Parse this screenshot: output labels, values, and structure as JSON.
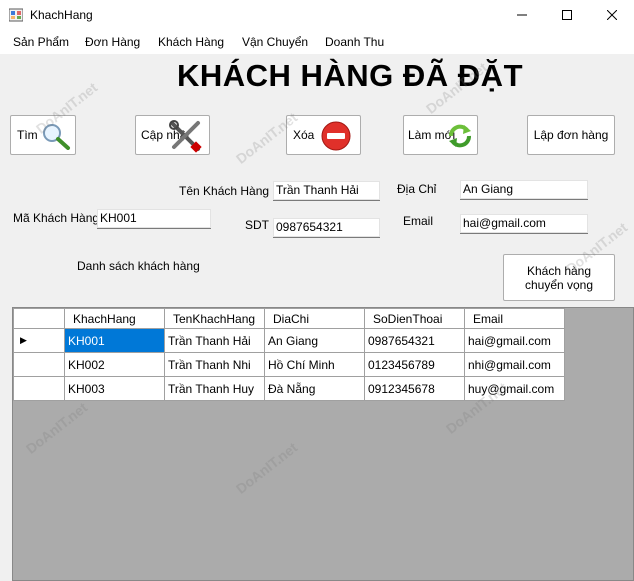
{
  "window": {
    "title": "KhachHang"
  },
  "menu": {
    "items": [
      "Sản Phẩm",
      "Đơn Hàng",
      "Khách Hàng",
      "Vận Chuyển",
      "Doanh Thu"
    ]
  },
  "header": {
    "title": "KHÁCH HÀNG ĐÃ ĐẶT"
  },
  "toolbar": {
    "search_label": "Tìm",
    "update_label": "Cập nhật",
    "delete_label": "Xóa",
    "refresh_label": "Làm mới",
    "create_order_label": "Lập đơn hàng",
    "potential_customers_label": "Khách hàng chuyển vọng"
  },
  "form": {
    "name_label": "Tên Khách Hàng",
    "name_value": "Trần Thanh Hải",
    "address_label": "Địa Chỉ",
    "address_value": "An Giang",
    "id_label": "Mã Khách Hàng",
    "id_value": "KH001",
    "phone_label": "SDT",
    "phone_value": "0987654321",
    "email_label": "Email",
    "email_value": "hai@gmail.com",
    "list_label": "Danh sách khách hàng"
  },
  "grid": {
    "columns": [
      "KhachHang",
      "TenKhachHang",
      "DiaChi",
      "SoDienThoai",
      "Email"
    ],
    "rows": [
      [
        "KH001",
        "Trần Thanh Hải",
        "An Giang",
        "0987654321",
        "hai@gmail.com"
      ],
      [
        "KH002",
        "Trần Thanh Nhi",
        "Hồ Chí Minh",
        "0123456789",
        "nhi@gmail.com"
      ],
      [
        "KH003",
        "Trần Thanh Huy",
        "Đà Nẵng",
        "0912345678",
        "huy@gmail.com"
      ]
    ],
    "current_row_marker": "▶"
  },
  "watermark": {
    "text": "DoAnIT.net"
  },
  "colors": {
    "selection": "#0078d7",
    "grid_background": "#ababab"
  }
}
